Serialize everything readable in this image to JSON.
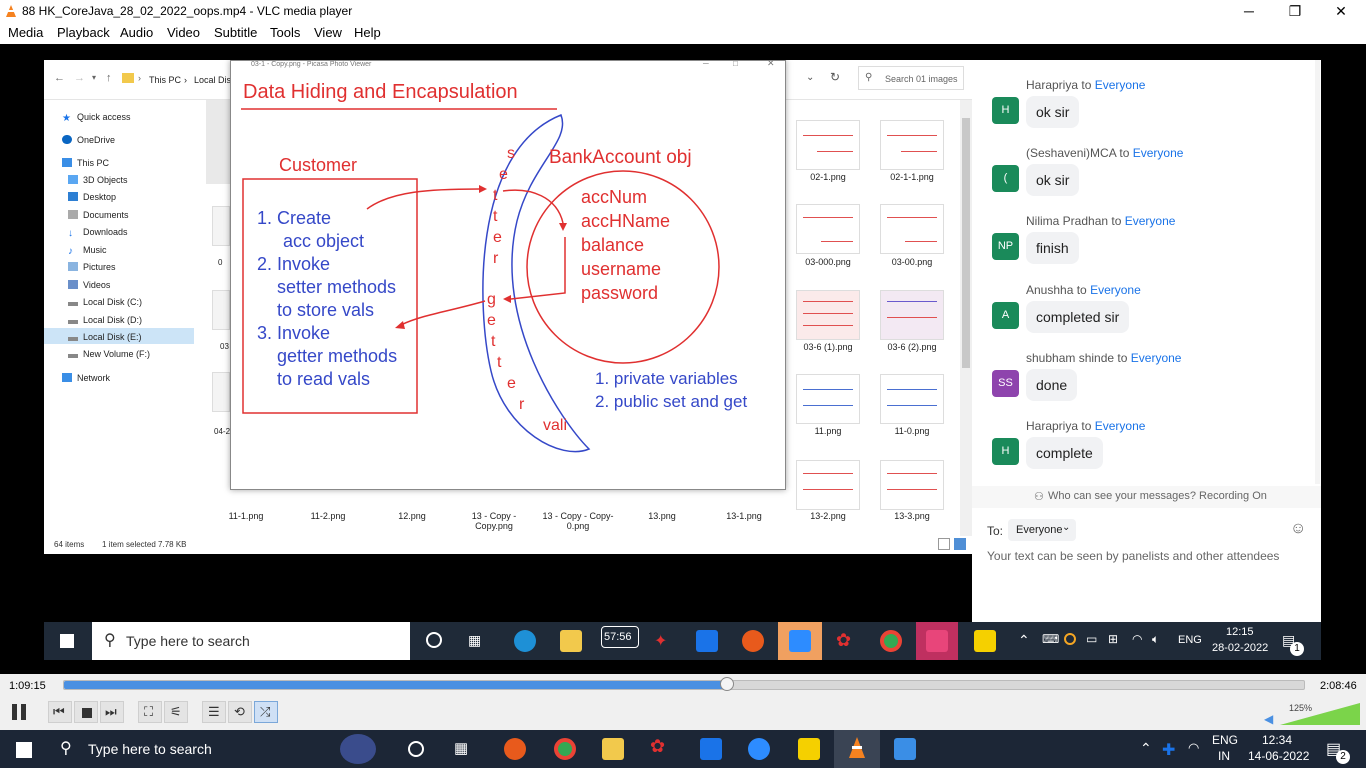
{
  "window": {
    "title": "88 HK_CoreJava_28_02_2022_oops.mp4 - VLC media player",
    "minimize": "─",
    "maximize": "❐",
    "close": "✕"
  },
  "menu": [
    "Media",
    "Playback",
    "Audio",
    "Video",
    "Subtitle",
    "Tools",
    "View",
    "Help"
  ],
  "explorer": {
    "breadcrumb_pc": "This PC",
    "breadcrumb_disk": "Local Dis",
    "search_placeholder": "Search 01 images",
    "nav": [
      "Quick access",
      "OneDrive",
      "This PC",
      "3D Objects",
      "Desktop",
      "Documents",
      "Downloads",
      "Music",
      "Pictures",
      "Videos",
      "Local Disk (C:)",
      "Local Disk (D:)",
      "Local Disk (E:)",
      "New Volume (F:)",
      "Network"
    ],
    "status_items": "64 items",
    "status_selected": "1 item selected  7.78 KB",
    "thumbs_right": [
      "02-1.png",
      "02-1-1.png",
      "03-000.png",
      "03-00.png",
      "03-6 (1).png",
      "03-6 (2).png",
      "11.png",
      "11-0.png",
      "13-2.png",
      "13-3.png"
    ],
    "thumbs_bottom": [
      "11-1.png",
      "11-2.png",
      "12.png",
      "13 - Copy - Copy.png",
      "13 - Copy - Copy-0.png",
      "13.png",
      "13-1.png"
    ],
    "left_stub_labels": [
      "0",
      "03",
      "04-2"
    ]
  },
  "picasa": {
    "title": "03-1 - Copy.png - Picasa Photo Viewer",
    "heading": "Data Hiding and Encapsulation",
    "customer": "Customer",
    "steps": [
      "1. Create",
      "acc object",
      "2. Invoke",
      "setter methods",
      "to store vals",
      "3. Invoke",
      "getter methods",
      "to read vals"
    ],
    "bank": "BankAccount obj",
    "fields": [
      "accNum",
      "accHName",
      "balance",
      "username",
      "password"
    ],
    "setter_letters": [
      "s",
      "e",
      "t",
      "t",
      "e",
      "r"
    ],
    "getter_letters": [
      "g",
      "e",
      "t",
      "t",
      "e",
      "r"
    ],
    "vali": "vali",
    "notes": [
      "1. private variables",
      "2. public set and get"
    ]
  },
  "chat": {
    "messages": [
      {
        "from": "Harapriya",
        "to": "Everyone",
        "initial": "H",
        "color": "#1a8a5a",
        "text": "ok sir"
      },
      {
        "from": "(Seshaveni)MCA",
        "to": "Everyone",
        "initial": "(",
        "color": "#1a8a5a",
        "text": "ok sir"
      },
      {
        "from": "Nilima Pradhan",
        "to": "Everyone",
        "initial": "NP",
        "color": "#1a8a5a",
        "text": "finish"
      },
      {
        "from": "Anushha",
        "to": "Everyone",
        "initial": "A",
        "color": "#1a8a5a",
        "text": "completed sir"
      },
      {
        "from": "shubham shinde",
        "to": "Everyone",
        "initial": "SS",
        "color": "#8e44ad",
        "text": "done"
      },
      {
        "from": "Harapriya",
        "to": "Everyone",
        "initial": "H",
        "color": "#1a8a5a",
        "text": "complete"
      }
    ],
    "to_word": "to",
    "who_can_see": "Who can see your messages? Recording On",
    "to_label": "To:",
    "recipient": "Everyone",
    "placeholder": "Your text can be seen by panelists and other attendees"
  },
  "inner_taskbar": {
    "search": "Type here to search",
    "clock_badge": "57:56",
    "lang": "ENG",
    "time": "12:15",
    "date": "28-02-2022",
    "notif": "1"
  },
  "player": {
    "elapsed": "1:09:15",
    "total": "2:08:46",
    "progress": 0.535,
    "volume": "125%",
    "volume_level": 1.0
  },
  "taskbar": {
    "search": "Type here to search",
    "lang": "ENG",
    "region": "IN",
    "time": "12:34",
    "date": "14-06-2022",
    "notif": "2"
  }
}
